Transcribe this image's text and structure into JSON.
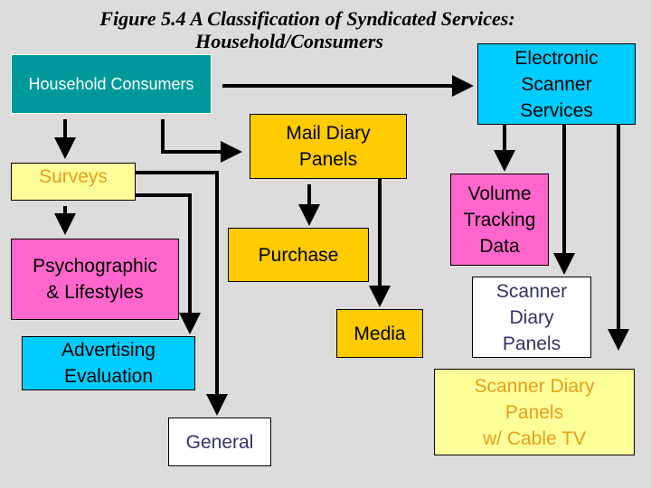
{
  "title": {
    "line1": "Figure 5.4  A Classification of Syndicated Services:",
    "line2": "Household/Consumers"
  },
  "nodes": {
    "household": {
      "label": "Household Consumers",
      "fill": "#009999",
      "text_color": "#ffffff"
    },
    "electronic": {
      "label": "Electronic\nScanner\nServices",
      "fill": "#00ccff",
      "text_color": "#000000"
    },
    "mail_diary": {
      "label": "Mail Diary\nPanels",
      "fill": "#ffcc00",
      "text_color": "#000000"
    },
    "surveys": {
      "label": "Surveys",
      "fill": "#ffff99",
      "text_color": "#e6a020"
    },
    "volume": {
      "label": "Volume\nTracking\nData",
      "fill": "#ff66cc",
      "text_color": "#000000"
    },
    "psychographic": {
      "label": "Psychographic\n& Lifestyles",
      "fill": "#ff66cc",
      "text_color": "#000000"
    },
    "purchase": {
      "label": "Purchase",
      "fill": "#ffcc00",
      "text_color": "#000000"
    },
    "scanner_diary": {
      "label": "Scanner\nDiary\nPanels",
      "fill": "#ffffff",
      "text_color": "#333366"
    },
    "media": {
      "label": "Media",
      "fill": "#ffcc00",
      "text_color": "#000000"
    },
    "advertising": {
      "label": "Advertising\nEvaluation",
      "fill": "#00ccff",
      "text_color": "#000000"
    },
    "cable_tv": {
      "label": "Scanner Diary\nPanels\nw/ Cable TV",
      "fill": "#ffff99",
      "text_color": "#e6a020"
    },
    "general": {
      "label": "General",
      "fill": "#ffffff",
      "text_color": "#333366"
    }
  },
  "edges": [
    {
      "from": "household",
      "to": "electronic"
    },
    {
      "from": "household",
      "to": "surveys"
    },
    {
      "from": "household",
      "to": "mail_diary"
    },
    {
      "from": "surveys",
      "to": "psychographic"
    },
    {
      "from": "surveys",
      "to": "advertising"
    },
    {
      "from": "surveys",
      "to": "general"
    },
    {
      "from": "mail_diary",
      "to": "purchase"
    },
    {
      "from": "mail_diary",
      "to": "media"
    },
    {
      "from": "electronic",
      "to": "volume"
    },
    {
      "from": "electronic",
      "to": "scanner_diary"
    },
    {
      "from": "electronic",
      "to": "cable_tv"
    }
  ]
}
